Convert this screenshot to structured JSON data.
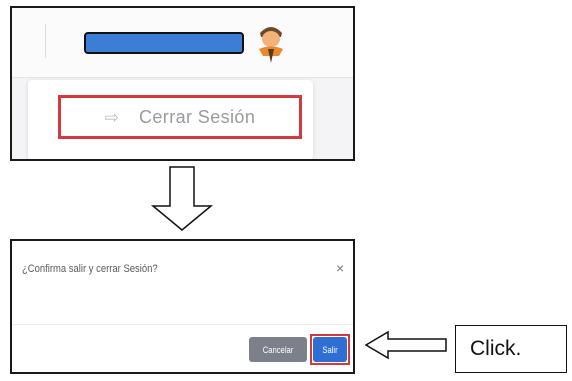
{
  "user_menu": {
    "username_redacted_color": "#3a7fd5",
    "avatar_icon": "user-avatar-icon",
    "logout": {
      "icon": "sign-out-arrow-icon",
      "label": "Cerrar Sesión",
      "highlight_color": "#d23a3f"
    }
  },
  "flow_arrow_icon": "down-arrow-icon",
  "dialog": {
    "title": "¿Confirma salir y cerrar Sesión?",
    "close_label": "×",
    "cancel_label": "Cancelar",
    "exit_label": "Salir",
    "cancel_color": "#7b808a",
    "exit_color": "#2f6fd3"
  },
  "annotation": {
    "pointer_icon": "left-arrow-icon",
    "callout_label": "Click."
  }
}
